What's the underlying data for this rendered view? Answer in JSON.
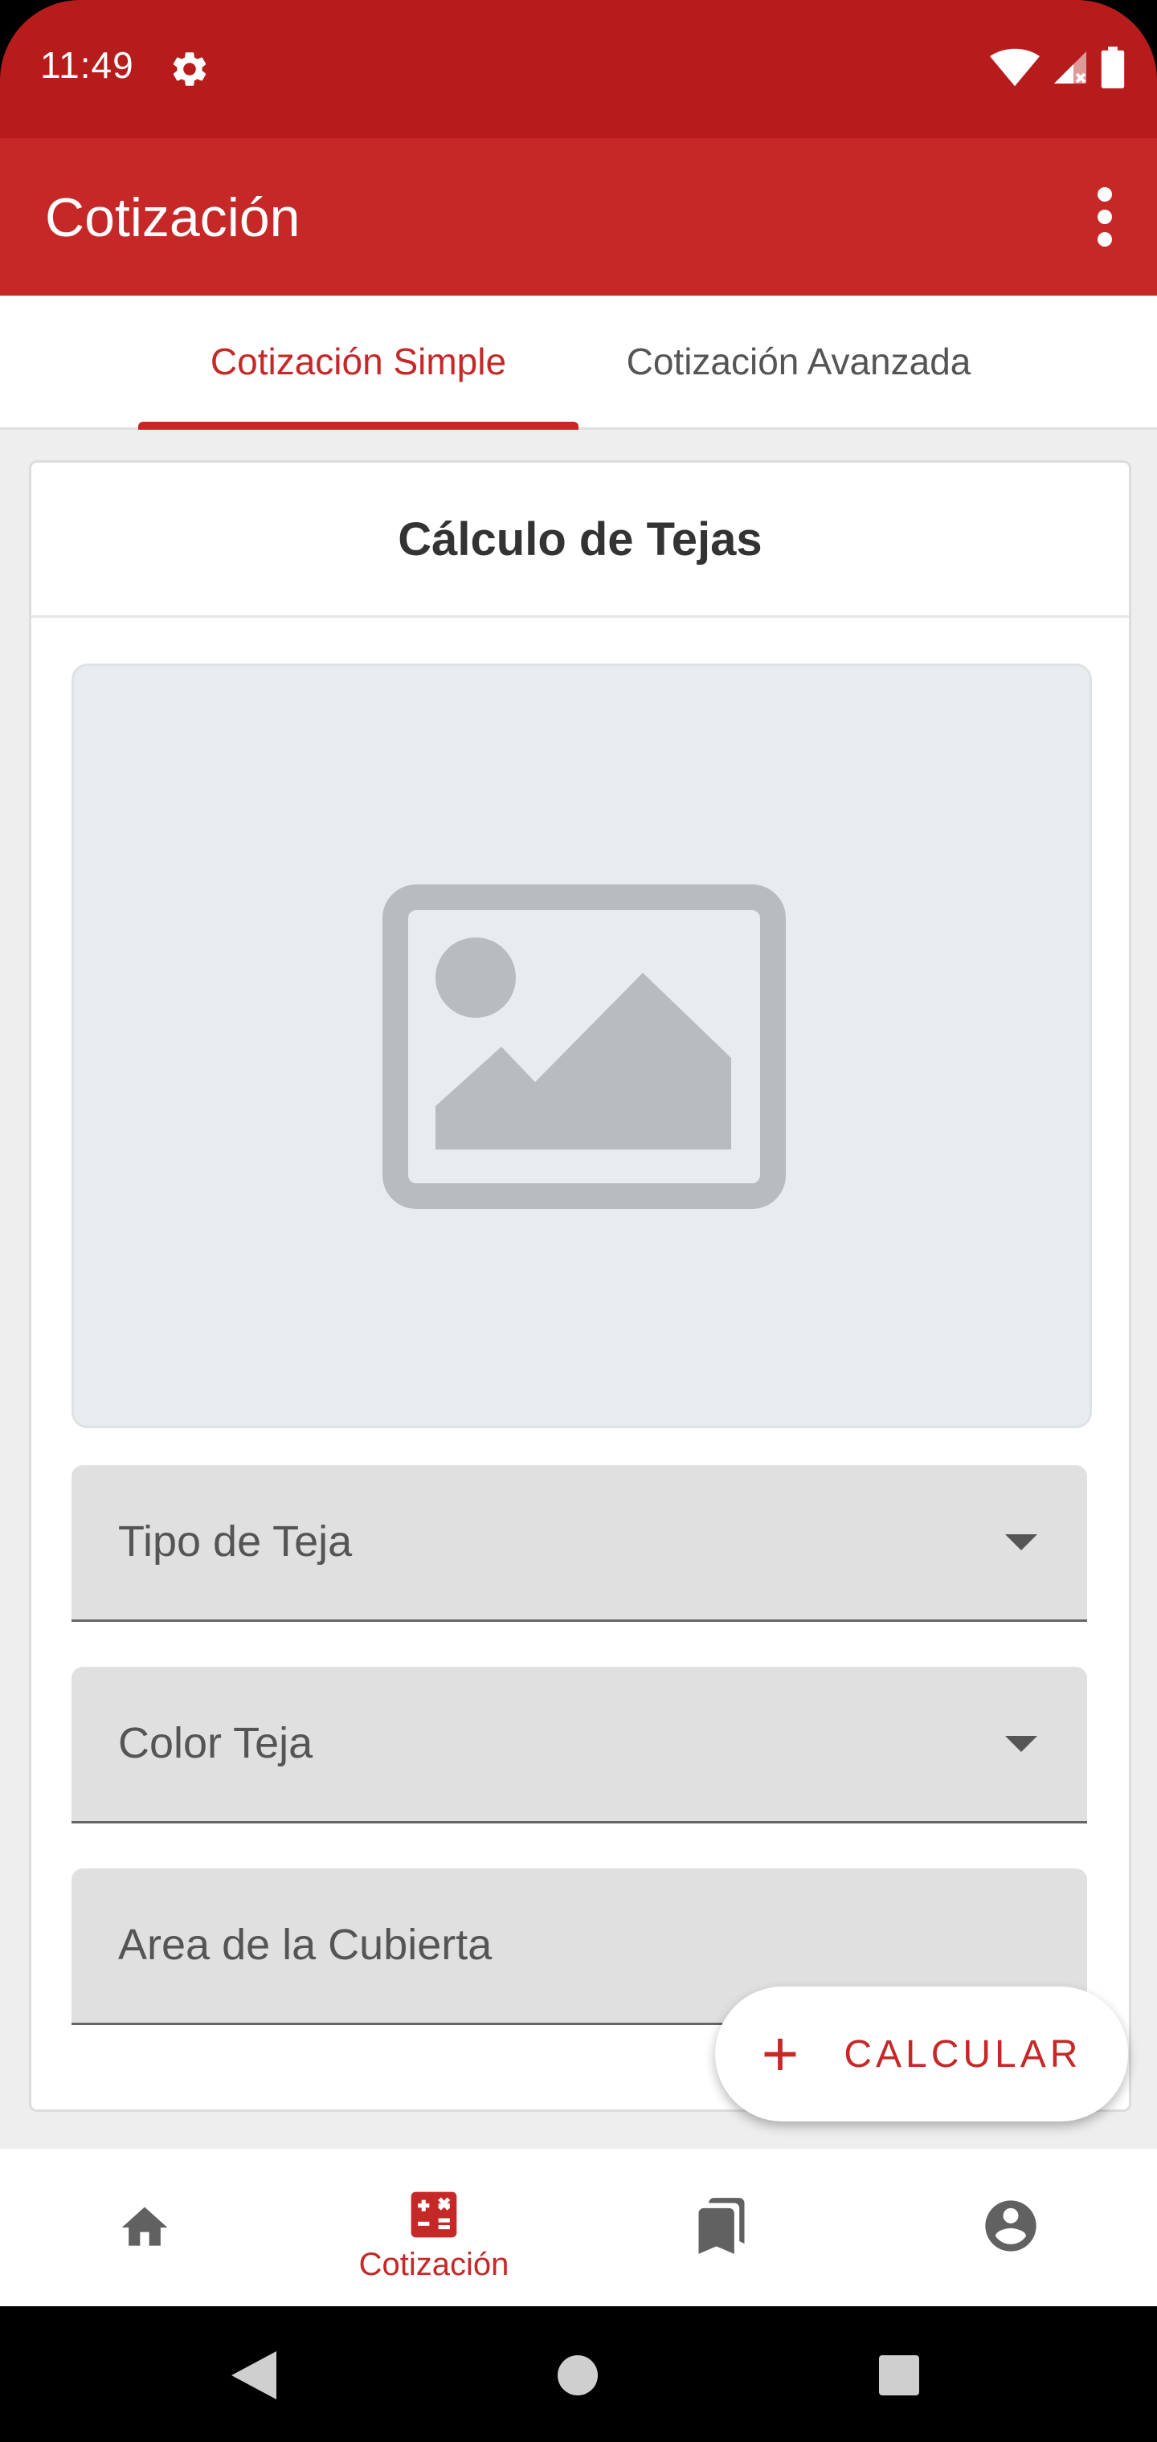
{
  "status_bar": {
    "time": "11:49"
  },
  "app_bar": {
    "title": "Cotización"
  },
  "tabs": [
    {
      "label": "Cotización Simple",
      "selected": true
    },
    {
      "label": "Cotización Avanzada",
      "selected": false
    }
  ],
  "card": {
    "title": "Cálculo de Tejas",
    "fields": [
      {
        "label": "Tipo de Teja",
        "type": "dropdown"
      },
      {
        "label": "Color Teja",
        "type": "dropdown"
      },
      {
        "label": "Area de la Cubierta",
        "type": "text"
      }
    ]
  },
  "fab": {
    "label": "CALCULAR",
    "icon": "plus-icon"
  },
  "bottom_nav": {
    "items": [
      {
        "icon": "home-icon",
        "label": ""
      },
      {
        "icon": "calculator-icon",
        "label": "Cotización",
        "selected": true
      },
      {
        "icon": "bookmarks-icon",
        "label": ""
      },
      {
        "icon": "account-circle-icon",
        "label": ""
      }
    ]
  },
  "colors": {
    "primary": "#C62828",
    "primary_dark": "#B71C1C",
    "background": "#EEEEEE"
  }
}
